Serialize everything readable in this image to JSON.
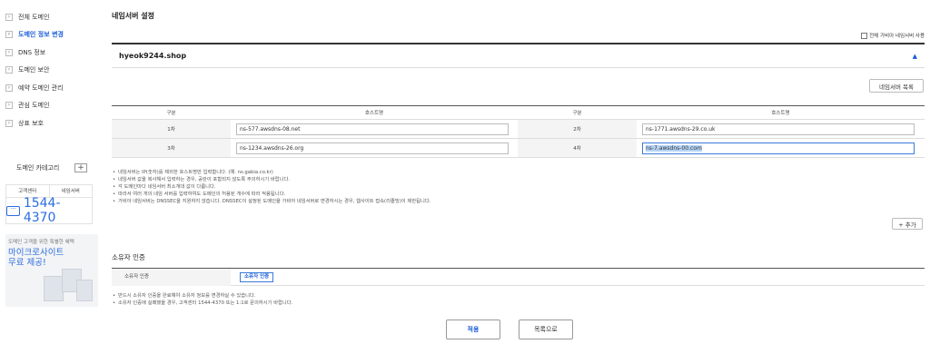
{
  "sidebar": {
    "items": [
      {
        "label": "전체 도메인",
        "active": false
      },
      {
        "label": "도메인 정보 변경",
        "active": true
      },
      {
        "label": "DNS 정보",
        "active": false
      },
      {
        "label": "도메인 보안",
        "active": false
      },
      {
        "label": "예약 도메인 관리",
        "active": false
      },
      {
        "label": "관심 도메인",
        "active": false
      },
      {
        "label": "상표 보호",
        "active": false
      }
    ],
    "category_label": "도메인 카테고리",
    "category_add": "+",
    "cs_tabs": [
      "고객센터",
      "네임서버"
    ],
    "phone": "1544-4370",
    "promo_line1": "도메인 고객을 위한 특별한 혜택",
    "promo_line2": "마이크로사이트",
    "promo_line3": "무료 제공!"
  },
  "main": {
    "title": "네임서버 설정",
    "use_all_label": "전체 가비아 네임서버 사용",
    "domain": "hyeok9244.shop",
    "collapse_glyph": "▲",
    "ns_list_button": "네임서버 목록",
    "table": {
      "headers": [
        "구분",
        "호스트명",
        "구분",
        "호스트명"
      ],
      "rows": [
        {
          "l1": "1차",
          "v1": "ns-577.awsdns-08.net",
          "l2": "2차",
          "v2": "ns-1771.awsdns-29.co.uk"
        },
        {
          "l1": "3차",
          "v1": "ns-1234.awsdns-26.org",
          "l2": "4차",
          "v2": "ns-7.awsdns-00.com"
        }
      ]
    },
    "notes": [
      "네임서버는 IP(숫자)를 제외한 호스트명만 입력합니다. (예. ns.gabia.co.kr)",
      "네임서버 값을 복사해서 입력하는 경우, 공란이 포함되지 않도록 주의하시기 바랍니다.",
      "각 도메인마다 네임서버 최소개대 값이 다릅니다.",
      "따라서 여러 개의 네임 서버를 입력하여도 도메인의 허용된 개수에 따라 적용됩니다.",
      "가비아 네임서버는 DNSSEC을 지원하지 않습니다. DNSSEC이 설정된 도메인을 가비아 네임서버로 변경하시는 경우, 웹사이트 접속(리졸빙)이 제한됩니다."
    ],
    "add_button": "+ 추가",
    "owner": {
      "title": "소유자 인증",
      "label": "소유자 인증",
      "button": "소유자 인증"
    },
    "owner_notes": [
      "반드시 소유자 인증을 완료해야 소유자 정보를 변경하실 수 있습니다.",
      "소유자 인증에 실패했을 경우, 고객센터 1544-4370 또는 1:1로 문의하시기 바랍니다."
    ],
    "apply_button": "적용",
    "list_button": "목록으로"
  },
  "colors": {
    "accent": "#1a5bd8",
    "phone": "#2b6de0",
    "focus": "#3b7ad9"
  }
}
